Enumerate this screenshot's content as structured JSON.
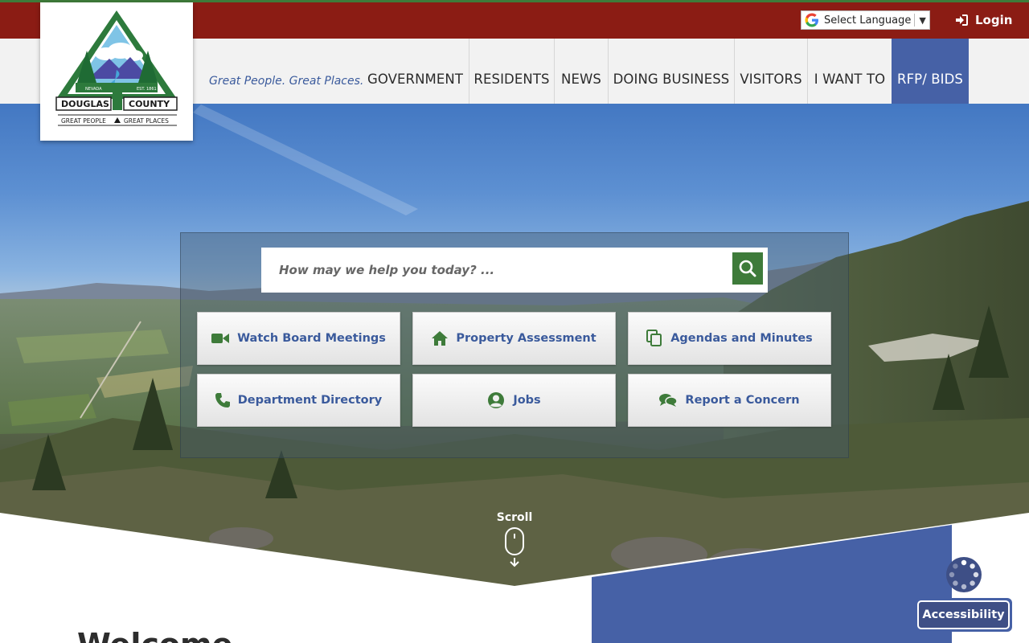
{
  "header": {
    "language_label": "Select Language",
    "login_label": "Login",
    "tagline": "Great People. Great Places."
  },
  "logo": {
    "name_left": "DOUGLAS",
    "name_right": "COUNTY",
    "state": "NEVADA",
    "established": "EST. 1861",
    "motto_left": "GREAT PEOPLE",
    "motto_right": "GREAT PLACES"
  },
  "nav": {
    "items": [
      {
        "label": "GOVERNMENT"
      },
      {
        "label": "RESIDENTS"
      },
      {
        "label": "NEWS"
      },
      {
        "label": "DOING BUSINESS"
      },
      {
        "label": "VISITORS"
      },
      {
        "label": "I WANT TO"
      },
      {
        "label": "RFP/ BIDS",
        "active": true
      }
    ]
  },
  "search": {
    "placeholder": "How may we help you today? ..."
  },
  "quick_links": [
    {
      "label": "Watch Board Meetings",
      "icon": "video-camera-icon"
    },
    {
      "label": "Property Assessment",
      "icon": "home-icon"
    },
    {
      "label": "Agendas and Minutes",
      "icon": "copy-icon"
    },
    {
      "label": "Department Directory",
      "icon": "phone-icon"
    },
    {
      "label": "Jobs",
      "icon": "user-circle-icon"
    },
    {
      "label": "Report a Concern",
      "icon": "comments-icon"
    }
  ],
  "scroll_label": "Scroll",
  "welcome_heading": "Welcome",
  "accessibility_label": "Accessibility",
  "colors": {
    "top_bar": "#8b1c14",
    "accent_green": "#3e7b3a",
    "nav_active": "#4661a6",
    "link_blue": "#3a5a9c"
  }
}
